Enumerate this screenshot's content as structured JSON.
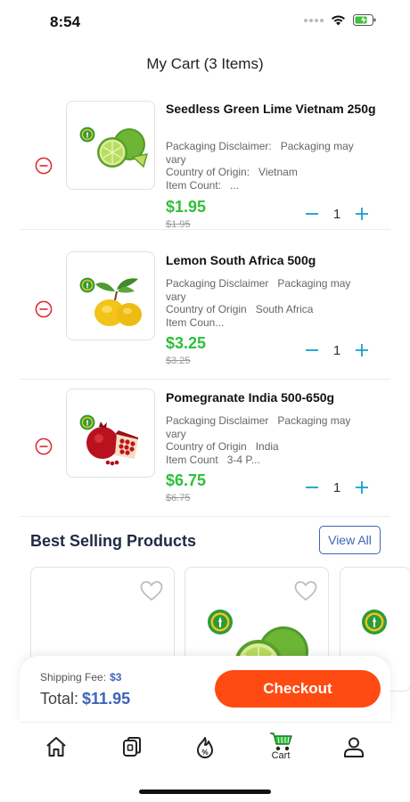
{
  "status_bar": {
    "time": "8:54"
  },
  "header": {
    "title": "My Cart (3 Items)"
  },
  "cart": {
    "items": [
      {
        "title": "Seedless Green Lime Vietnam 250g",
        "details": [
          {
            "k": "Packaging Disclaimer:",
            "v": "Packaging may"
          },
          {
            "k": "vary",
            "v": ""
          },
          {
            "k": "Country of Origin:",
            "v": "Vietnam"
          },
          {
            "k": "Item Count:",
            "v": "..."
          }
        ],
        "price": "$1.95",
        "old_price": "$1.95",
        "quantity": "1",
        "fruit": "lime"
      },
      {
        "title": "Lemon South Africa 500g",
        "details": [
          {
            "k": "Packaging Disclaimer",
            "v": "Packaging may"
          },
          {
            "k": "vary",
            "v": ""
          },
          {
            "k": "Country of Origin",
            "v": "South Africa"
          },
          {
            "k": "Item Coun...",
            "v": ""
          }
        ],
        "price": "$3.25",
        "old_price": "$3.25",
        "quantity": "1",
        "fruit": "lemon"
      },
      {
        "title": "Pomegranate India 500-650g",
        "details": [
          {
            "k": "Packaging Disclaimer",
            "v": "Packaging may"
          },
          {
            "k": "vary",
            "v": ""
          },
          {
            "k": "Country of Origin",
            "v": "India"
          },
          {
            "k": "Item Count",
            "v": "3-4 P..."
          }
        ],
        "price": "$6.75",
        "old_price": "$6.75",
        "quantity": "1",
        "fruit": "pomegranate"
      }
    ]
  },
  "best_selling": {
    "title": "Best Selling Products",
    "view_all_label": "View All"
  },
  "checkout": {
    "shipping_label": "Shipping Fee:",
    "shipping_value": "$3",
    "total_label": "Total:",
    "total_value": "$11.95",
    "button_label": "Checkout"
  },
  "tab_bar": {
    "tabs": [
      {
        "icon": "home-icon",
        "label": ""
      },
      {
        "icon": "categories-icon",
        "label": ""
      },
      {
        "icon": "deals-icon",
        "label": ""
      },
      {
        "icon": "cart-icon",
        "label": "Cart"
      },
      {
        "icon": "profile-icon",
        "label": ""
      }
    ]
  },
  "colors": {
    "price_green": "#2fbf3a",
    "accent_blue": "#3f64b8",
    "checkout_orange": "#ff4a12",
    "qty_blue": "#1a9ccf",
    "remove_red": "#e0262f"
  }
}
